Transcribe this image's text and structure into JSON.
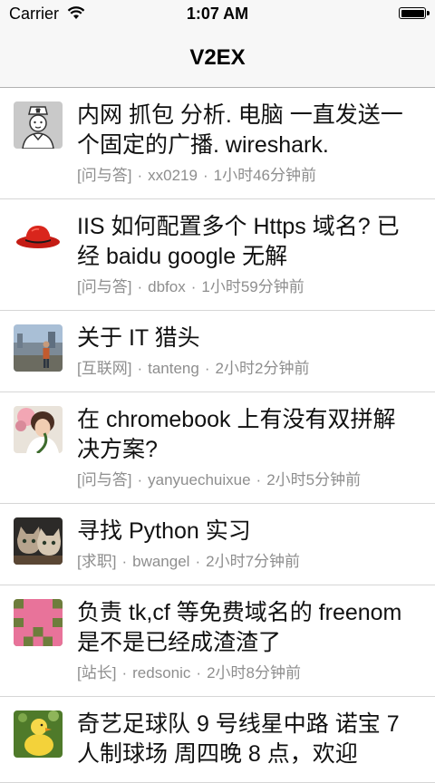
{
  "status_bar": {
    "carrier": "Carrier",
    "time": "1:07 AM"
  },
  "nav": {
    "title": "V2EX"
  },
  "topics": [
    {
      "title": "内网 抓包 分析. 电脑 一直发送一个固定的广播. wireshark.",
      "node": "[问与答]",
      "author": "xx0219",
      "time": "1小时46分钟前",
      "avatar": "nurse-avatar-icon"
    },
    {
      "title": "IIS 如何配置多个 Https 域名? 已经 baidu google 无解",
      "node": "[问与答]",
      "author": "dbfox",
      "time": "1小时59分钟前",
      "avatar": "red-hat-avatar-icon"
    },
    {
      "title": "关于 IT 猎头",
      "node": "[互联网]",
      "author": "tanteng",
      "time": "2小时2分钟前",
      "avatar": "photo-avatar-icon"
    },
    {
      "title": "在 chromebook 上有没有双拼解决方案?",
      "node": "[问与答]",
      "author": "yanyuechuixue",
      "time": "2小时5分钟前",
      "avatar": "photo-avatar-icon"
    },
    {
      "title": "寻找 Python 实习",
      "node": "[求职]",
      "author": "bwangel",
      "time": "2小时7分钟前",
      "avatar": "cats-avatar-icon"
    },
    {
      "title": "负责 tk,cf 等免费域名的 freenom 是不是已经成渣渣了",
      "node": "[站长]",
      "author": "redsonic",
      "time": "2小时8分钟前",
      "avatar": "pixel-avatar-icon"
    },
    {
      "title": "奇艺足球队 9 号线星中路 诺宝 7 人制球场 周四晚 8 点，欢迎",
      "node": "",
      "author": "",
      "time": "",
      "avatar": "duck-avatar-icon"
    }
  ]
}
